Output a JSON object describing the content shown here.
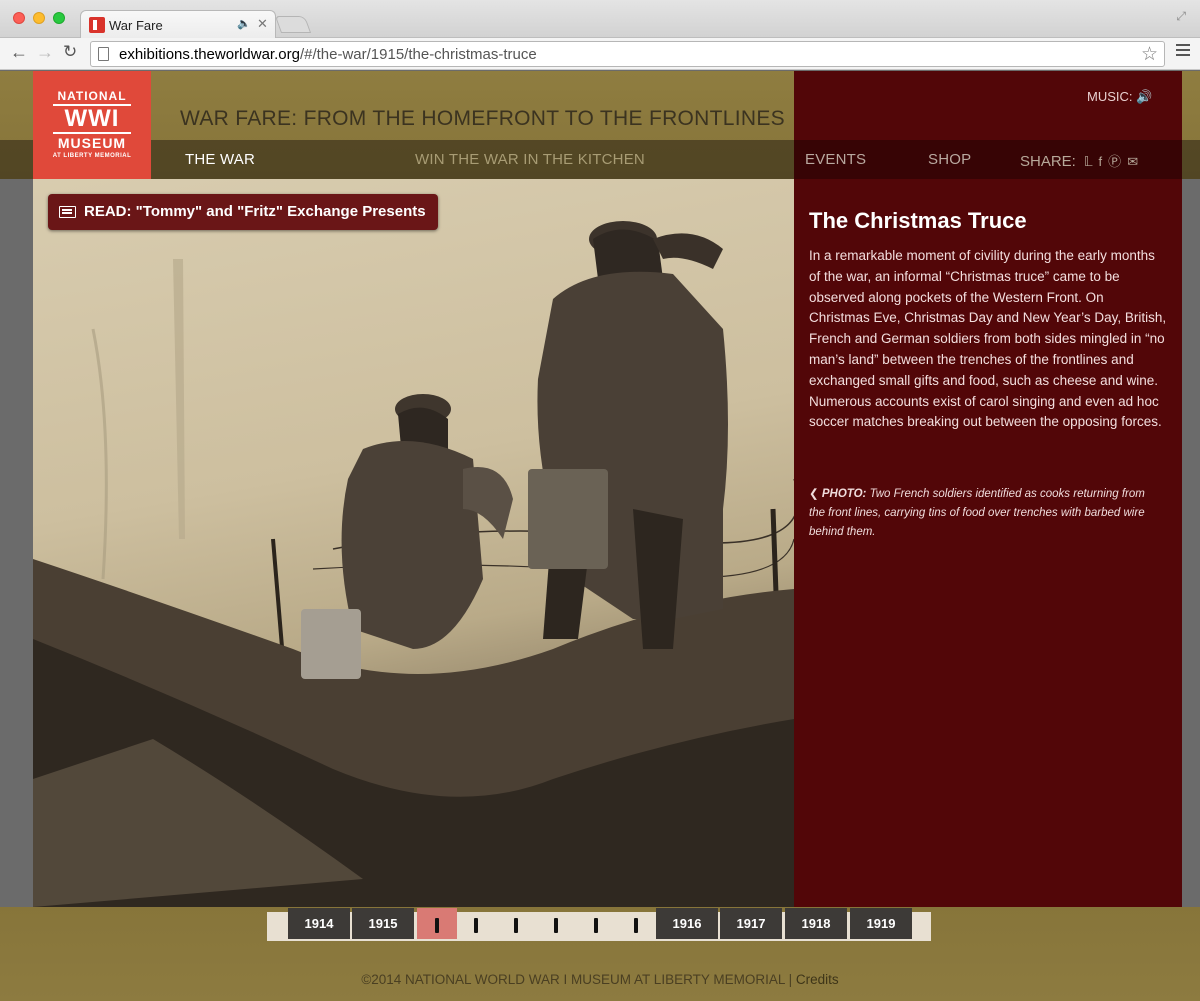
{
  "browser": {
    "tab_title": "War Fare",
    "url_host": "exhibitions.theworldwar.org",
    "url_path": "/#/the-war/1915/the-christmas-truce"
  },
  "logo": {
    "line1": "NATIONAL",
    "line2": "WWI",
    "line3": "MUSEUM",
    "line4": "AT LIBERTY MEMORIAL"
  },
  "header": {
    "title": "WAR FARE: FROM THE HOMEFRONT TO THE FRONTLINES",
    "music_label": "MUSIC:"
  },
  "nav": {
    "the_war": "THE WAR",
    "kitchen": "WIN THE WAR IN THE KITCHEN",
    "events": "EVENTS",
    "shop": "SHOP",
    "share": "SHARE:"
  },
  "read_button": "READ: \"Tommy\" and \"Fritz\" Exchange Presents",
  "article": {
    "title": "The Christmas Truce",
    "body": "In a remarkable moment of civility during the early months of the war, an informal “Christmas truce” came to be observed along pockets of the Western Front. On Christmas Eve, Christmas Day and New Year’s Day, British, French and German soldiers from both sides mingled in “no man’s land” between the trenches of the frontlines and exchanged small gifts and food, such as cheese and wine. Numerous accounts exist of carol singing and even ad hoc soccer matches breaking out between the opposing forces.",
    "caption_label": "PHOTO:",
    "caption": "Two French soldiers identified as cooks returning from the front lines, carrying tins of food over trenches with barbed wire behind them."
  },
  "timeline": {
    "years": [
      "1914",
      "1915",
      "1916",
      "1917",
      "1918",
      "1919"
    ]
  },
  "footer": {
    "copyright": "©2014 NATIONAL WORLD WAR I MUSEUM AT LIBERTY MEMORIAL",
    "separator": "|",
    "credits": "Credits"
  },
  "colors": {
    "olive": "#8b7a3e",
    "maroon": "#520608",
    "logo_red": "#e0493a",
    "timeline_active": "#d97a74"
  }
}
